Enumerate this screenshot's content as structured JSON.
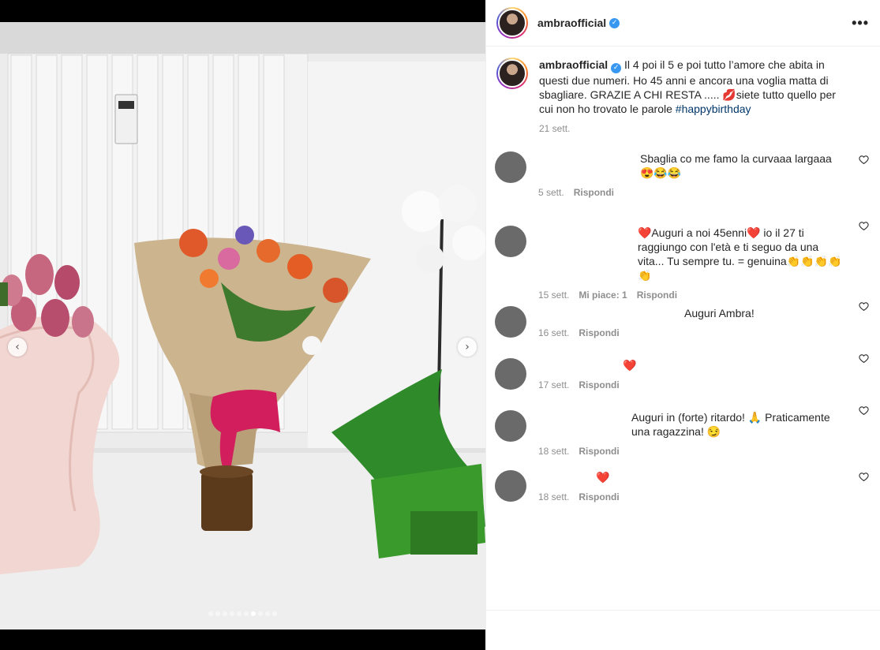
{
  "post": {
    "username": "ambraofficial",
    "verified": true,
    "more_label": "•••",
    "carousel": {
      "total_slides": 10,
      "active_slide": 7
    }
  },
  "caption": {
    "username": "ambraofficial",
    "text": "Il 4 poi il 5 e poi tutto l’amore che abita in questi due numeri. Ho 45 anni e ancora una voglia matta di sbagliare. GRAZIE A CHI RESTA ..... 💋siete tutto quello per cui non ho trovato le parole",
    "hashtag": "#happybirthday",
    "time": "21 sett."
  },
  "comments": [
    {
      "text": "Sbaglia co me famo la curvaaa largaaa 😍😂😂",
      "time": "5 sett.",
      "likes": "",
      "reply": "Rispondi"
    },
    {
      "text": "❤️Auguri a noi 45enni❤️ io il 27 ti raggiungo con l'età e ti seguo da una vita... Tu sempre tu. = genuina👏👏👏👏👏",
      "time": "15 sett.",
      "likes": "Mi piace: 1",
      "reply": "Rispondi"
    },
    {
      "text": "Auguri Ambra!",
      "time": "16 sett.",
      "likes": "",
      "reply": "Rispondi"
    },
    {
      "text": "❤️",
      "time": "17 sett.",
      "likes": "",
      "reply": "Rispondi"
    },
    {
      "text": "Auguri in (forte) ritardo! 🙏 Praticamente una ragazzina! 😏",
      "time": "18 sett.",
      "likes": "",
      "reply": "Rispondi"
    },
    {
      "text": "❤️",
      "time": "18 sett.",
      "likes": "",
      "reply": "Rispondi"
    }
  ],
  "colors": {
    "verified_blue": "#3897f0",
    "hashtag_blue": "#00376b",
    "muted_gray": "#8e8e8e"
  }
}
